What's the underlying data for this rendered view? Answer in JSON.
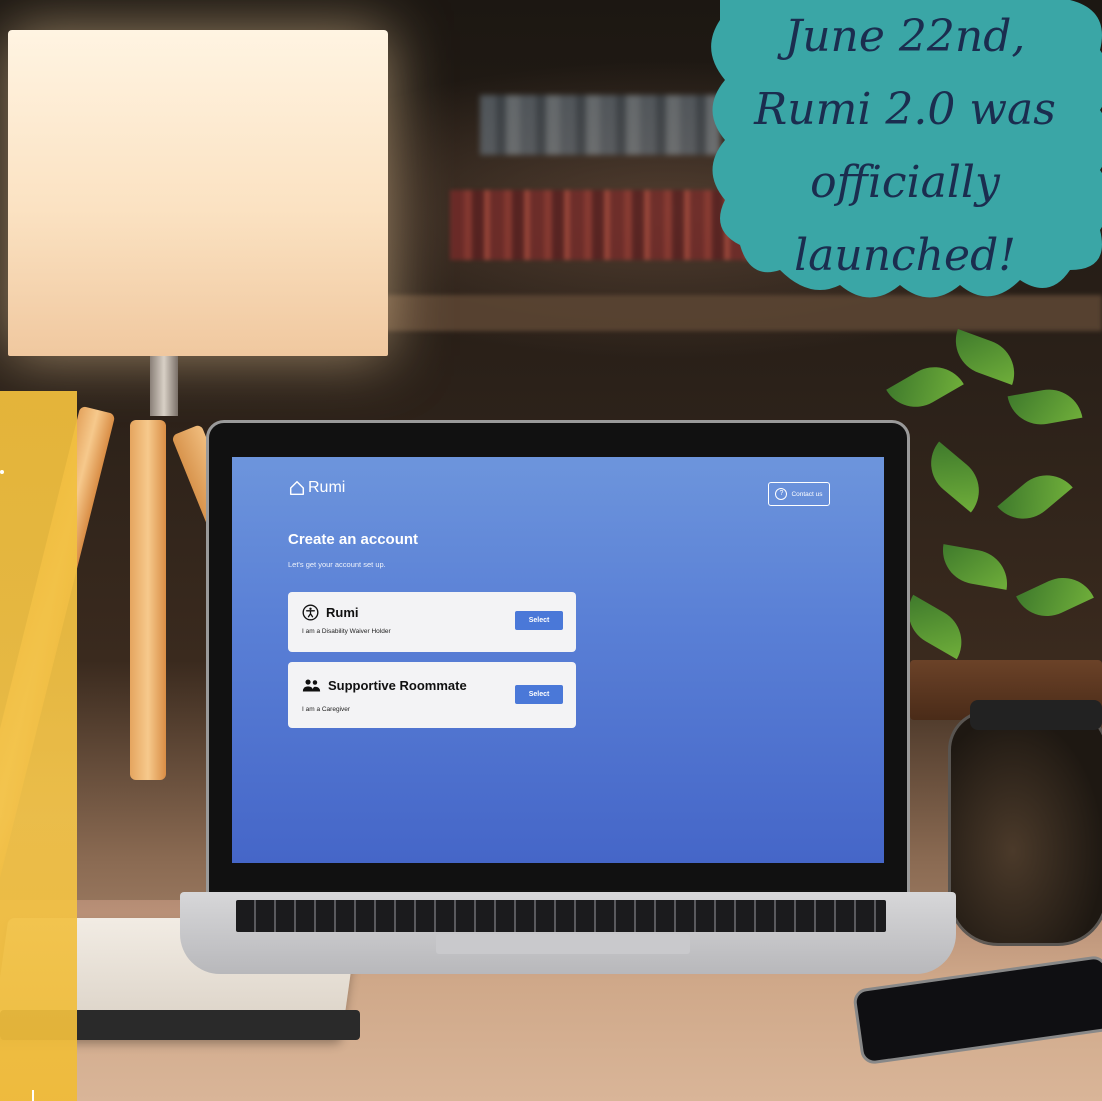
{
  "badge": {
    "lines": [
      "June 22nd,",
      "Rumi 2.0 was",
      "officially",
      "launched!"
    ],
    "color": "#3aa6a6",
    "text_color": "#1b2d4f"
  },
  "side_strip_color": "#f1bf3c",
  "app": {
    "logo_text": "Rumi",
    "logo_icon": "house-icon",
    "contact_label": "Contact us",
    "contact_icon": "question-circle-icon",
    "title": "Create an account",
    "subtitle": "Let's get your account set up.",
    "accent": "#4a78d8",
    "background_top": "#6d95dc",
    "background_bottom": "#4566c8",
    "cards": [
      {
        "icon": "accessibility-icon",
        "title": "Rumi",
        "description": "I am a Disability Waiver Holder",
        "button": "Select"
      },
      {
        "icon": "people-icon",
        "title": "Supportive Roommate",
        "description": "I am a Caregiver",
        "button": "Select"
      }
    ]
  }
}
